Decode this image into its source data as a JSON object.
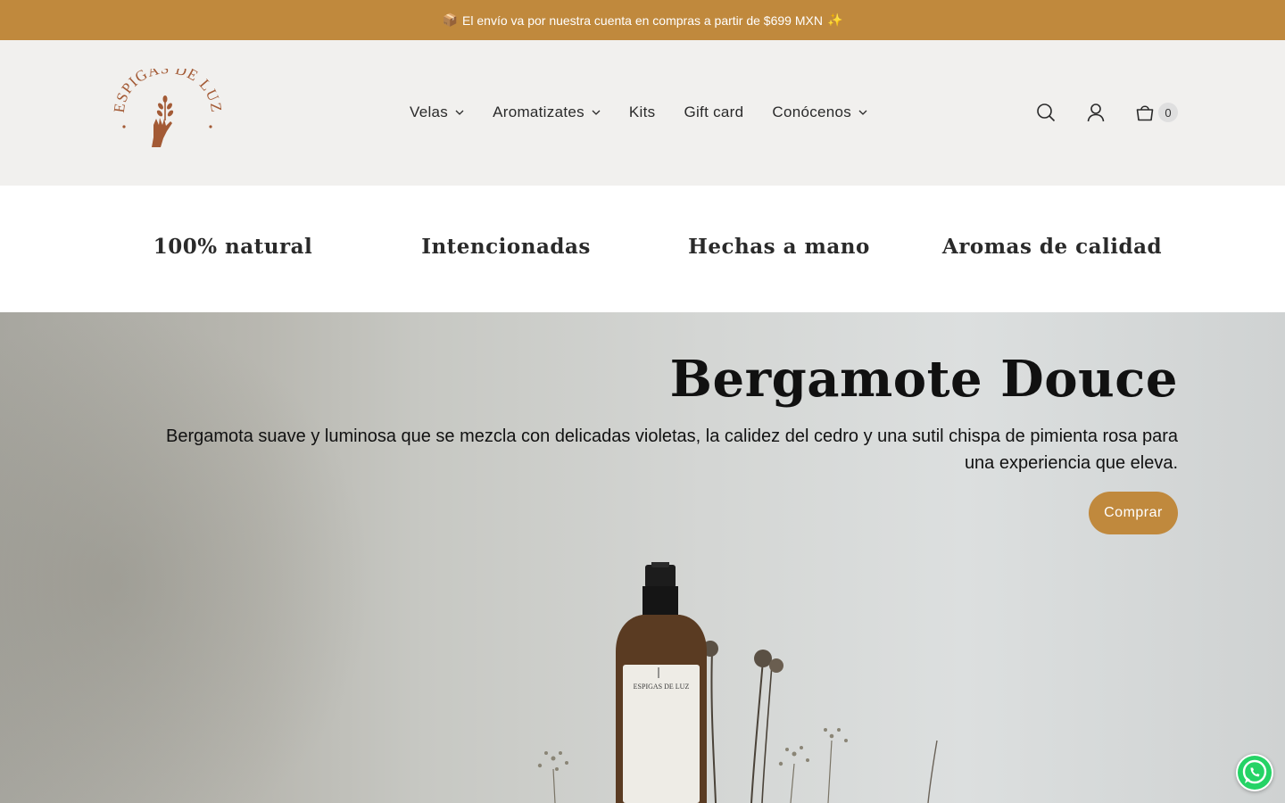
{
  "announcement": {
    "emoji_start": "📦",
    "text": "El envío va por nuestra cuenta en compras a partir de $699 MXN",
    "emoji_end": "✨"
  },
  "logo": {
    "text": "ESPIGAS DE LUZ"
  },
  "nav": {
    "items": [
      {
        "label": "Velas",
        "has_dropdown": true
      },
      {
        "label": "Aromatizates",
        "has_dropdown": true
      },
      {
        "label": "Kits",
        "has_dropdown": false
      },
      {
        "label": "Gift card",
        "has_dropdown": false
      },
      {
        "label": "Conócenos",
        "has_dropdown": true
      }
    ]
  },
  "header_icons": {
    "search": "search-icon",
    "account": "account-icon",
    "cart": "cart-icon",
    "cart_count": "0"
  },
  "values": [
    "100% natural",
    "Intencionadas",
    "Hechas a mano",
    "Aromas de calidad"
  ],
  "hero": {
    "title": "Bergamote Douce",
    "description": "Bergamota suave y luminosa que se mezcla con delicadas violetas, la calidez del cedro y una sutil chispa de pimienta rosa para una experiencia que eleva.",
    "button_label": "Comprar",
    "product_label": "ESPIGAS DE LUZ"
  },
  "colors": {
    "accent": "#c0893d",
    "header_bg": "#f1f0ee",
    "logo": "#a35a35"
  }
}
